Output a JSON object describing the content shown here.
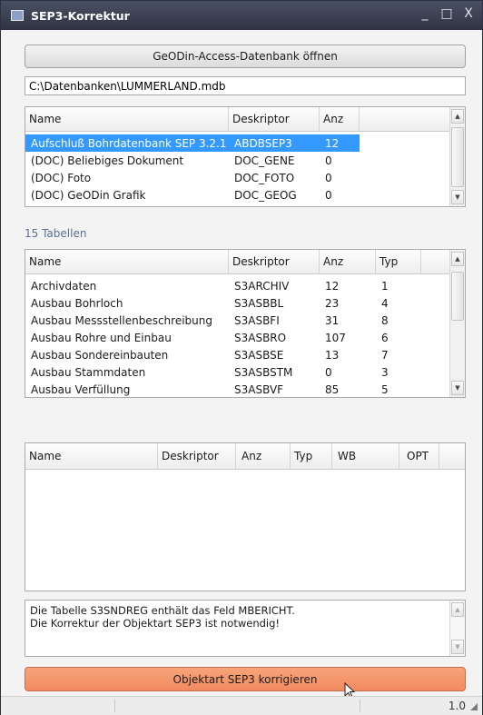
{
  "window": {
    "title": "SEP3-Korrektur",
    "controls": {
      "minimize": "_",
      "maximize": "□",
      "close": "X"
    }
  },
  "open_button": {
    "label": "GeODin-Access-Datenbank öffnen"
  },
  "db_path": {
    "value": "C:\\Datenbanken\\LUMMERLAND.mdb"
  },
  "objects_table": {
    "columns": [
      "Name",
      "Deskriptor",
      "Anz",
      ""
    ],
    "rows": [
      {
        "name": "Aufschluß Bohrdatenbank SEP 3.2.1",
        "desc": "ABDBSEP3",
        "anz": "12",
        "selected": true
      },
      {
        "name": "(DOC) Beliebiges Dokument",
        "desc": "DOC_GENE",
        "anz": "0"
      },
      {
        "name": "(DOC) Foto",
        "desc": "DOC_FOTO",
        "anz": "0"
      },
      {
        "name": "(DOC) GeODin Grafik",
        "desc": "DOC_GEOG",
        "anz": "0"
      }
    ]
  },
  "tables_count_label": "15 Tabellen",
  "tables_table": {
    "columns": [
      "Name",
      "Deskriptor",
      "Anz",
      "Typ",
      ""
    ],
    "rows": [
      {
        "name": "Archivdaten",
        "desc": "S3ARCHIV",
        "anz": "12",
        "typ": "1"
      },
      {
        "name": "Ausbau Bohrloch",
        "desc": "S3ASBBL",
        "anz": "23",
        "typ": "4"
      },
      {
        "name": "Ausbau Messstellenbeschreibung",
        "desc": "S3ASBFI",
        "anz": "31",
        "typ": "8"
      },
      {
        "name": "Ausbau Rohre und Einbau",
        "desc": "S3ASBRO",
        "anz": "107",
        "typ": "6"
      },
      {
        "name": "Ausbau Sondereinbauten",
        "desc": "S3ASBSE",
        "anz": "13",
        "typ": "7"
      },
      {
        "name": "Ausbau Stammdaten",
        "desc": "S3ASBSTM",
        "anz": "0",
        "typ": "3"
      },
      {
        "name": "Ausbau Verfüllung",
        "desc": "S3ASBVF",
        "anz": "85",
        "typ": "5"
      }
    ]
  },
  "fields_table": {
    "columns": [
      "Name",
      "Deskriptor",
      "Anz",
      "Typ",
      "WB",
      "OPT"
    ]
  },
  "message": {
    "line1": "Die Tabelle S3SNDREG enthält das Feld MBERICHT.",
    "line2": "Die Korrektur der Objektart SEP3 ist notwendig!"
  },
  "fix_button": {
    "label": "Objektart SEP3 korrigieren"
  },
  "status": {
    "version": "1.0"
  },
  "colors": {
    "selection": "#3399ff",
    "fix_button": "#f28a5f",
    "titlebar": "#3a3f50"
  }
}
